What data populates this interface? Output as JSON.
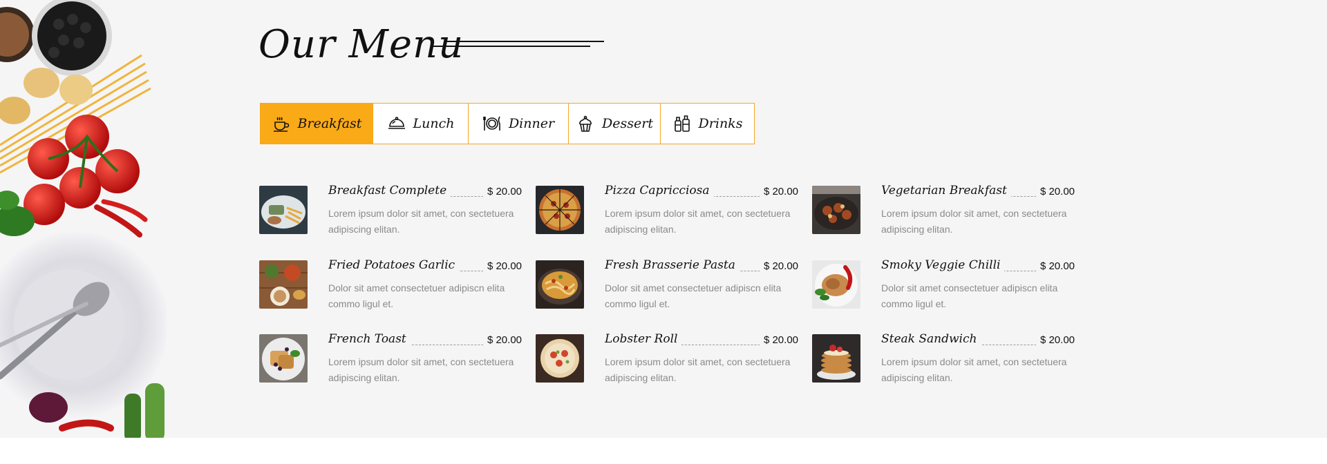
{
  "section": {
    "title": "Our Menu"
  },
  "tabs": [
    {
      "label": "Breakfast",
      "icon": "coffee-cup-icon",
      "active": true
    },
    {
      "label": "Lunch",
      "icon": "cloche-icon",
      "active": false
    },
    {
      "label": "Dinner",
      "icon": "plate-cutlery-icon",
      "active": false
    },
    {
      "label": "Dessert",
      "icon": "cupcake-icon",
      "active": false
    },
    {
      "label": "Drinks",
      "icon": "bottles-icon",
      "active": false
    }
  ],
  "menu": {
    "items": [
      {
        "name": "Breakfast Complete",
        "price": "$ 20.00",
        "desc": "Lorem ipsum dolor sit amet, con sectetuera adipiscing elitan."
      },
      {
        "name": "Pizza Capricciosa",
        "price": "$ 20.00",
        "desc": "Lorem ipsum dolor sit amet, con sectetuera adipiscing elitan."
      },
      {
        "name": "Vegetarian Breakfast",
        "price": "$ 20.00",
        "desc": "Lorem ipsum dolor sit amet, con sectetuera adipiscing elitan."
      },
      {
        "name": "Fried Potatoes Garlic",
        "price": "$ 20.00",
        "desc": "Dolor sit amet consectetuer adipiscn elita commo ligul et."
      },
      {
        "name": "Fresh Brasserie Pasta",
        "price": "$ 20.00",
        "desc": "Dolor sit amet consectetuer adipiscn elita commo ligul et."
      },
      {
        "name": "Smoky Veggie Chilli",
        "price": "$ 20.00",
        "desc": "Dolor sit amet consectetuer adipiscn elita commo ligul et."
      },
      {
        "name": "French Toast",
        "price": "$ 20.00",
        "desc": "Lorem ipsum dolor sit amet, con sectetuera adipiscing elitan."
      },
      {
        "name": "Lobster Roll",
        "price": "$ 20.00",
        "desc": "Lorem ipsum dolor sit amet, con sectetuera adipiscing elitan."
      },
      {
        "name": "Steak Sandwich",
        "price": "$ 20.00",
        "desc": "Lorem ipsum dolor sit amet, con sectetuera adipiscing elitan."
      }
    ]
  },
  "colors": {
    "accent": "#fbaa17",
    "background": "#f5f5f5",
    "text": "#111111",
    "muted": "#8a8a8a"
  }
}
